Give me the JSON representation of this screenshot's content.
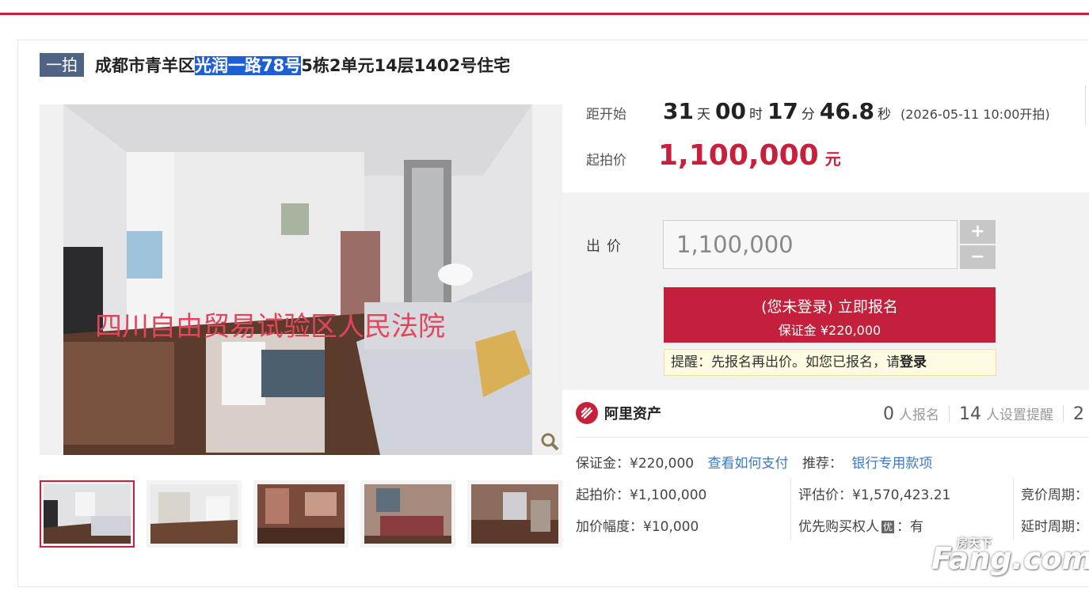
{
  "header": {
    "badge": "一拍",
    "title_pre": "成都市青羊区",
    "title_sel": "光润一路78号",
    "title_post": "5栋2单元14层1402号住宅"
  },
  "photo": {
    "watermark_text": "四川自由贸易试验区人民法院",
    "thumb_count": 5,
    "active_thumb": 0
  },
  "countdown": {
    "label": "距开始",
    "days": "31",
    "days_unit": "天",
    "hours": "00",
    "hours_unit": "时",
    "minutes": "17",
    "minutes_unit": "分",
    "seconds": "46.8",
    "seconds_unit": "秒",
    "start_text": "(2026-05-11 10:00开拍)"
  },
  "start_price": {
    "label": "起拍价",
    "value": "1,100,000",
    "unit": "元"
  },
  "bid": {
    "label": "出价",
    "placeholder": "1,100,000",
    "plus": "+",
    "minus": "−"
  },
  "signup": {
    "line1": "(您未登录) 立即报名",
    "line2": "保证金 ¥220,000"
  },
  "tip": {
    "text": "提醒：先报名再出价。如您已报名，请",
    "login": "登录"
  },
  "platform": {
    "name": "阿里资产"
  },
  "stats": {
    "signup_count": "0",
    "signup_label": "人报名",
    "remind_count": "14",
    "remind_label": "人设置提醒",
    "third_count": "2"
  },
  "details": {
    "deposit": "保证金：¥220,000",
    "how_pay": "查看如何支付",
    "recommend": "推荐：",
    "bank": "银行专用款项",
    "start_price": "起拍价：¥1,100,000",
    "appraisal": "评估价：¥1,570,423.21",
    "bid_period": "竞价周期：",
    "increment": "加价幅度：¥10,000",
    "priority": "优先购买权人",
    "priority_icon": "优",
    "priority_val": "：有",
    "delay_period": "延时周期："
  },
  "brand_watermark": {
    "text": "Fang.com",
    "cn": "房天下"
  },
  "colors": {
    "accent": "#c8203a",
    "badge": "#4f6384",
    "link": "#3b78c6"
  }
}
